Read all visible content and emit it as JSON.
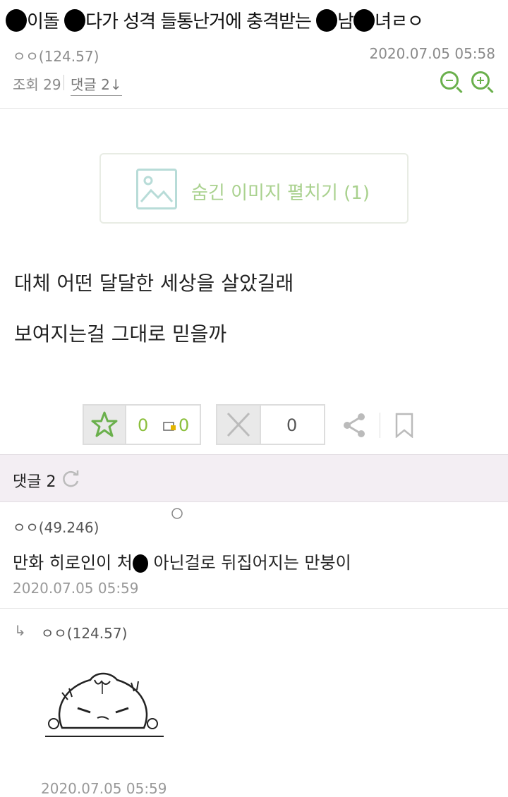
{
  "post": {
    "title_part1": "이돌",
    "title_part2": "다가 성격 들통난거에 충격받는",
    "title_part3": "남",
    "title_part4": "녀ㄹㅇ",
    "author": "ㅇㅇ(124.57)",
    "date": "2020.07.05 05:58",
    "views": "조회 29",
    "comments_link": "댓글 2↓",
    "hidden_image_label": "숨긴 이미지 펼치기 (1)",
    "body": [
      "대체 어떤 달달한 세상을 살았길래",
      "보여지는걸 그대로 믿을까"
    ]
  },
  "votes": {
    "like_count": "0",
    "lock_count": "0",
    "dislike_count": "0"
  },
  "comments": {
    "header_label": "댓글 2",
    "items": [
      {
        "author": "ㅇㅇ(49.246)",
        "text_part1": "만화 히로인이 처",
        "text_part2": "아닌걸로 뒤집어지는 만붕이",
        "date": "2020.07.05 05:59"
      },
      {
        "reply_marker": "↳",
        "author": "ㅇㅇ(124.57)",
        "date": "2020.07.05 05:59"
      }
    ]
  },
  "colors": {
    "accent_green": "#6ab04c",
    "comment_header_bg": "#f3eef3"
  }
}
